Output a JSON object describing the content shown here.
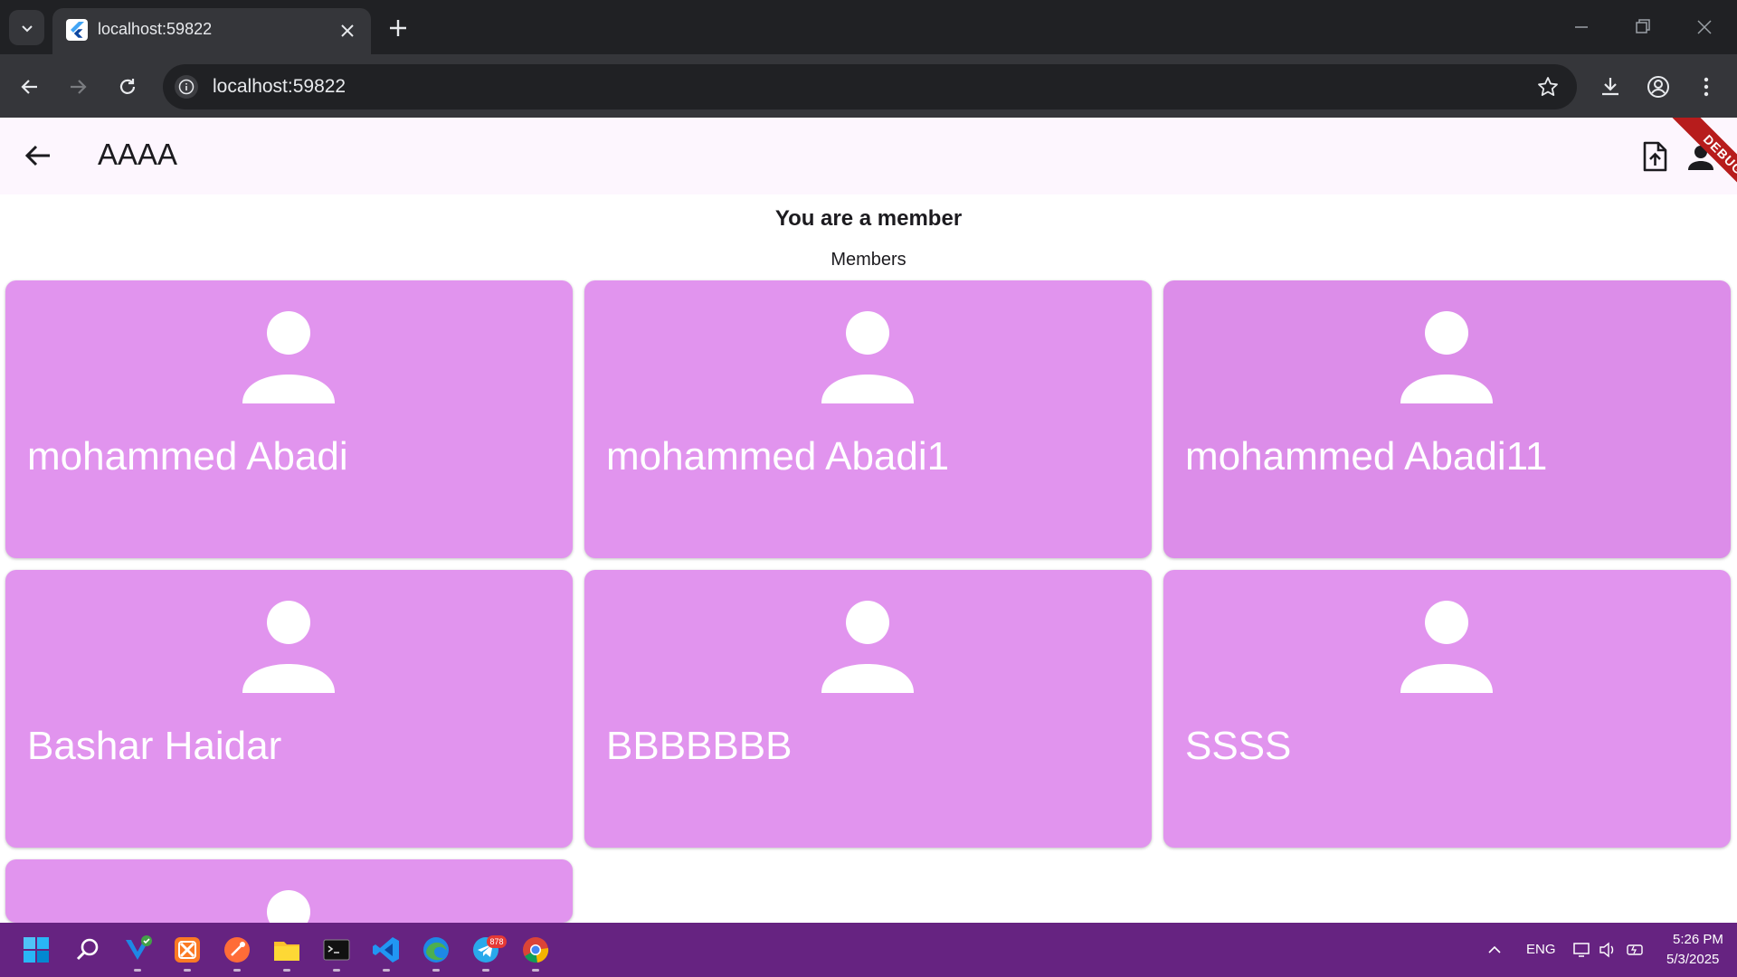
{
  "browser": {
    "tab_title": "localhost:59822",
    "url": "localhost:59822"
  },
  "app": {
    "title": "AAAA",
    "debug_banner": "DEBUG"
  },
  "status_text": "You are a member",
  "section_title": "Members",
  "members": [
    {
      "name": "mohammed Abadi"
    },
    {
      "name": "mohammed Abadi1"
    },
    {
      "name": "mohammed Abadi11"
    },
    {
      "name": "Bashar Haidar"
    },
    {
      "name": "BBBBBBB"
    },
    {
      "name": "SSSS"
    },
    {
      "name": ""
    }
  ],
  "taskbar": {
    "apps": [
      "windows-start",
      "search",
      "vs-code-insiders",
      "xampp",
      "postman",
      "file-explorer",
      "terminal",
      "vs-code",
      "edge",
      "telegram",
      "chrome"
    ],
    "telegram_badge": "878",
    "language": "ENG",
    "time": "5:26 PM",
    "date": "5/3/2025"
  },
  "colors": {
    "card": "#e194ee",
    "appbar": "#fdf6fe",
    "taskbar": "#662381",
    "chrome_dark": "#202124"
  }
}
